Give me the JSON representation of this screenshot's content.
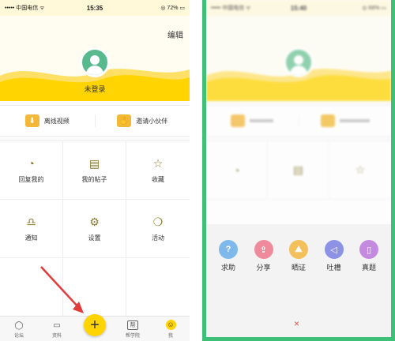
{
  "left": {
    "status": {
      "carrier": "••••• 中国电信 ᯤ",
      "time": "15:35",
      "battery": "◎ 72% ▭"
    },
    "edit_label": "编辑",
    "login_label": "未登录",
    "quick_actions": [
      {
        "label": "离线视频",
        "icon": "download-icon",
        "color": "#f3b73a"
      },
      {
        "label": "邀请小伙伴",
        "icon": "handshake-icon",
        "color": "#f1b935"
      }
    ],
    "grid": [
      {
        "label": "回复我的",
        "icon": "chat-bubble-icon",
        "glyph": "💬"
      },
      {
        "label": "我的帖子",
        "icon": "document-icon",
        "glyph": "▤"
      },
      {
        "label": "收藏",
        "icon": "star-icon",
        "glyph": "☆"
      },
      {
        "label": "通知",
        "icon": "bell-icon",
        "glyph": "🔔"
      },
      {
        "label": "设置",
        "icon": "gear-icon",
        "glyph": "⚙"
      },
      {
        "label": "活动",
        "icon": "balloon-icon",
        "glyph": "🎈"
      }
    ],
    "tabs": [
      {
        "label": "论坛",
        "icon": "forum-icon",
        "glyph": "⋯"
      },
      {
        "label": "资料",
        "icon": "monitor-icon",
        "glyph": "▭"
      },
      {
        "label": "",
        "icon": "plus-icon",
        "glyph": "+"
      },
      {
        "label": "帮学院",
        "icon": "academy-icon",
        "glyph": "帮"
      },
      {
        "label": "我",
        "icon": "smile-face-icon",
        "glyph": "☺"
      }
    ]
  },
  "right": {
    "status": {
      "carrier": "••••• 中国电信 ᯤ",
      "time": "15:40",
      "battery": "◎ 68% ▭"
    },
    "share_actions": [
      {
        "label": "求助",
        "icon": "question-icon",
        "glyph": "?",
        "color": "#7fb8ea"
      },
      {
        "label": "分享",
        "icon": "share-icon",
        "glyph": "⇪",
        "color": "#ee8a9a"
      },
      {
        "label": "晒证",
        "icon": "mountain-photo-icon",
        "glyph": "⛰",
        "color": "#f3c05c"
      },
      {
        "label": "吐槽",
        "icon": "speaker-icon",
        "glyph": "🔊",
        "color": "#8d92e6"
      },
      {
        "label": "真题",
        "icon": "paper-icon",
        "glyph": "▯",
        "color": "#c48ae0"
      }
    ],
    "close_glyph": "×"
  },
  "colors": {
    "accent_yellow": "#ffd400",
    "green_border": "#3fc079",
    "avatar_green": "#58b98f"
  }
}
